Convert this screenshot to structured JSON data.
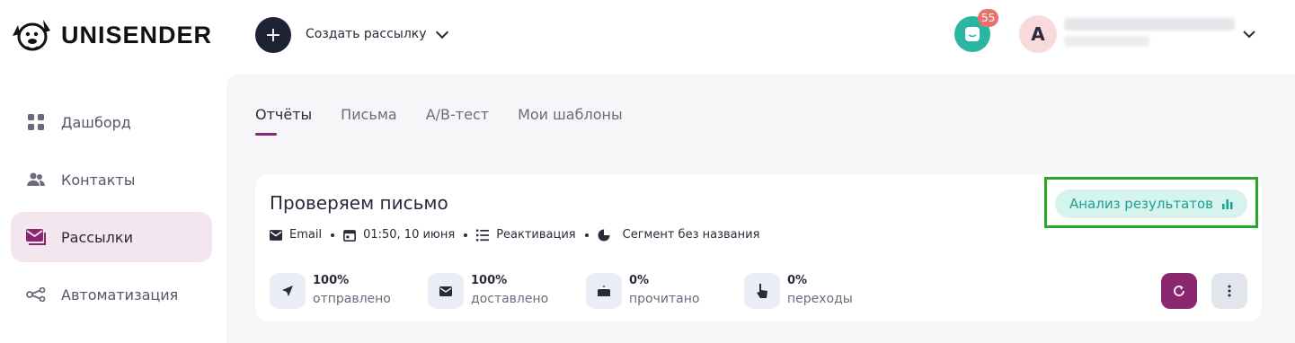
{
  "brand": {
    "name": "UNISENDER"
  },
  "header": {
    "create_label": "Создать рассылку",
    "create_plus": "+",
    "notifications_count": "55",
    "avatar_letter": "A"
  },
  "sidebar": {
    "items": [
      {
        "label": "Дашборд",
        "icon": "dashboard-icon"
      },
      {
        "label": "Контакты",
        "icon": "contacts-icon"
      },
      {
        "label": "Рассылки",
        "icon": "mail-icon",
        "active": true
      },
      {
        "label": "Автоматизация",
        "icon": "automation-icon"
      }
    ]
  },
  "tabs": [
    {
      "label": "Отчёты",
      "active": true
    },
    {
      "label": "Письма"
    },
    {
      "label": "A/B-тест"
    },
    {
      "label": "Мои шаблоны"
    }
  ],
  "report": {
    "title": "Проверяем письмо",
    "channel": "Email",
    "datetime": "01:50, 10 июня",
    "list": "Реактивация",
    "segment": "Сегмент без названия",
    "analysis_label": "Анализ результатов",
    "stats": [
      {
        "value": "100%",
        "label": "отправлено",
        "icon": "send-icon"
      },
      {
        "value": "100%",
        "label": "доставлено",
        "icon": "envelope-icon"
      },
      {
        "value": "0%",
        "label": "прочитано",
        "icon": "open-envelope-icon"
      },
      {
        "value": "0%",
        "label": "переходы",
        "icon": "pointer-hand-icon"
      }
    ]
  },
  "colors": {
    "accent": "#8a2770",
    "teal": "#2bb5a4",
    "badge": "#e8736a",
    "highlight_border": "#28a828"
  }
}
